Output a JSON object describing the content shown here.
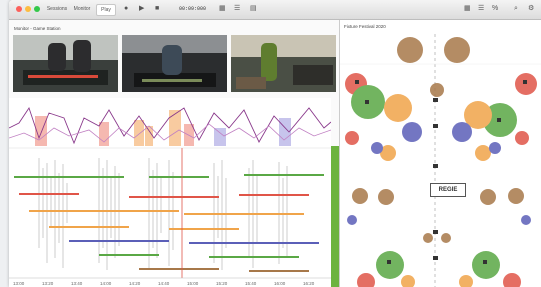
{
  "toolbar": {
    "sessions_label": "Sessions",
    "monitor_label": "Monitor",
    "play_label": "Play",
    "timecode": "00:09:000"
  },
  "left_panel": {
    "title": "Monitor - Game Station"
  },
  "right_panel": {
    "title": "Fixture Festival 2020",
    "center_label": "REGIE"
  },
  "timeline": {
    "ticks": [
      "13:00",
      "13:20",
      "13:40",
      "14:00",
      "14:20",
      "14:40",
      "15:00",
      "15:20",
      "15:40",
      "16:00",
      "16:20"
    ]
  },
  "colors": {
    "red": "#e05548",
    "orange": "#f0a44a",
    "green": "#5aa845",
    "blue": "#5b5fb8",
    "brown": "#a7784a",
    "purple": "#8a3a8c"
  },
  "icons": [
    "play-icon",
    "stop-icon",
    "record-icon",
    "grid-icon",
    "sliders-icon",
    "search-icon",
    "gear-icon",
    "fullscreen-icon"
  ]
}
